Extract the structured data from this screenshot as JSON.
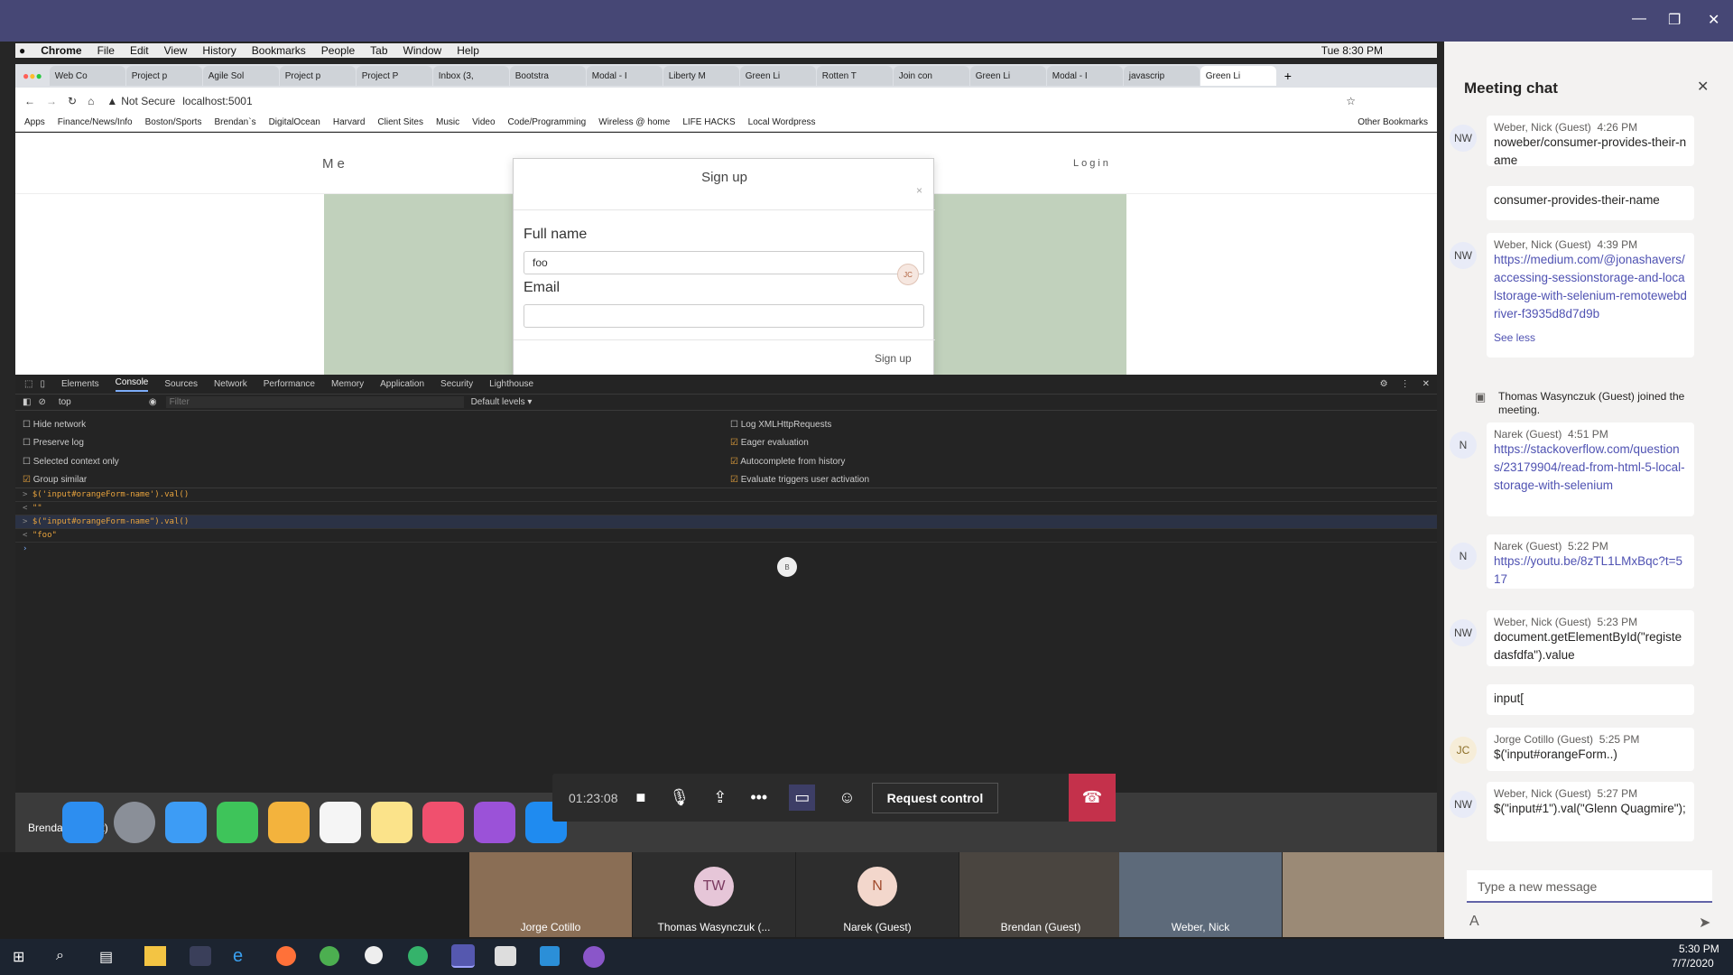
{
  "teams": {
    "window_title": ""
  },
  "mac_menu": {
    "items": [
      "Chrome",
      "File",
      "Edit",
      "View",
      "History",
      "Bookmarks",
      "People",
      "Tab",
      "Window",
      "Help"
    ],
    "clock": "Tue 8:30 PM"
  },
  "chrome": {
    "tabs": [
      "Web Co",
      "Project p",
      "Agile Sol",
      "Project p",
      "Project P",
      "Inbox (3,",
      "Bootstra",
      "Modal - I",
      "Liberty M",
      "Green Li",
      "Rotten T",
      "Join con",
      "Green Li",
      "Modal - I",
      "javascrip",
      "Green Li"
    ],
    "not_secure": "Not Secure",
    "url": "localhost:5001",
    "bookmarks": [
      "Apps",
      "Finance/News/Info",
      "Boston/Sports",
      "Brendan`s",
      "DigitalOcean",
      "Harvard",
      "Client Sites",
      "Music",
      "Video",
      "Code/Programming",
      "Wireless @ home",
      "LIFE HACKS",
      "Local Wordpress"
    ],
    "other_bookmarks": "Other Bookmarks"
  },
  "site": {
    "nav_left": "Me",
    "nav_right": "Login",
    "modal": {
      "title": "Sign up",
      "close": "×",
      "fullname_label": "Full name",
      "fullname_value": "foo",
      "email_label": "Email",
      "email_value": "",
      "submit": "Sign up",
      "cursor_badge": "JC"
    }
  },
  "devtools": {
    "tabs": [
      "Elements",
      "Console",
      "Sources",
      "Network",
      "Performance",
      "Memory",
      "Application",
      "Security",
      "Lighthouse"
    ],
    "context": "top",
    "filter_placeholder": "Filter",
    "levels": "Default levels ▾",
    "settings_left": [
      {
        "label": "Hide network",
        "checked": false
      },
      {
        "label": "Preserve log",
        "checked": false
      },
      {
        "label": "Selected context only",
        "checked": false
      },
      {
        "label": "Group similar",
        "checked": true
      }
    ],
    "settings_right": [
      {
        "label": "Log XMLHttpRequests",
        "checked": false
      },
      {
        "label": "Eager evaluation",
        "checked": true
      },
      {
        "label": "Autocomplete from history",
        "checked": true
      },
      {
        "label": "Evaluate triggers user activation",
        "checked": true
      }
    ],
    "console_lines": [
      {
        "prefix": ">",
        "text": "$('input#orangeForm-name').val()",
        "kind": "input"
      },
      {
        "prefix": "<",
        "text": "\"\"",
        "kind": "output"
      },
      {
        "prefix": ">",
        "text": "$(\"input#orangeForm-name\").val()",
        "kind": "input"
      },
      {
        "prefix": "<",
        "text": "\"foo\"",
        "kind": "output"
      }
    ],
    "cursor_badge": "B"
  },
  "dock": {
    "user_label": "Brendan (Guest)"
  },
  "call": {
    "timer": "01:23:08",
    "request_control": "Request control"
  },
  "videos": [
    {
      "name": "Jorge Cotillo",
      "initials": ""
    },
    {
      "name": "Thomas Wasynczuk (...",
      "initials": "TW"
    },
    {
      "name": "Narek (Guest)",
      "initials": "N"
    },
    {
      "name": "Brendan (Guest)",
      "initials": ""
    },
    {
      "name": "Weber, Nick",
      "initials": ""
    },
    {
      "name": "",
      "initials": ""
    }
  ],
  "chat": {
    "title": "Meeting chat",
    "messages": [
      {
        "avatar": "NW",
        "author": "Weber, Nick (Guest)",
        "time": "4:26 PM",
        "text": "noweber/consumer-provides-their-name"
      },
      {
        "avatar": "",
        "author": "",
        "time": "",
        "text": "consumer-provides-their-name"
      },
      {
        "avatar": "NW",
        "author": "Weber, Nick (Guest)",
        "time": "4:39 PM",
        "text": "https://medium.com/@jonashavers/accessing-sessionstorage-and-localstorage-with-selenium-remotewebdriver-f3935d8d7d9b",
        "see_less": "See less"
      },
      {
        "system": "Thomas Wasynczuk (Guest) joined the meeting."
      },
      {
        "avatar": "N",
        "author": "Narek (Guest)",
        "time": "4:51 PM",
        "text": "https://stackoverflow.com/questions/23179904/read-from-html-5-local-storage-with-selenium"
      },
      {
        "avatar": "N",
        "author": "Narek (Guest)",
        "time": "5:22 PM",
        "text": "https://youtu.be/8zTL1LMxBqc?t=517"
      },
      {
        "avatar": "NW",
        "author": "Weber, Nick (Guest)",
        "time": "5:23 PM",
        "text": "document.getElementById(\"registedasfdfa\").value"
      },
      {
        "avatar": "",
        "author": "",
        "time": "",
        "text": "input["
      },
      {
        "avatar": "JC",
        "author": "Jorge Cotillo (Guest)",
        "time": "5:25 PM",
        "text": "$('input#orangeForm..)"
      },
      {
        "avatar": "NW",
        "author": "Weber, Nick (Guest)",
        "time": "5:27 PM",
        "text": "$(\"input#1\").val(\"Glenn Quagmire\");"
      }
    ],
    "compose_placeholder": "Type a new message"
  },
  "taskbar": {
    "time": "5:30 PM",
    "date": "7/7/2020"
  },
  "colors": {
    "teams_purple": "#464775",
    "accent": "#6264a7",
    "hangup": "#c4314b",
    "sage": "#c1d1bc"
  }
}
